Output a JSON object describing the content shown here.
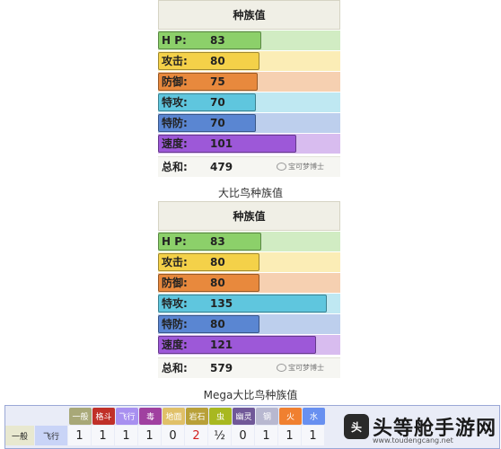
{
  "card1": {
    "title": "种族值",
    "stats": [
      {
        "label": "H P:",
        "value": "83",
        "fraction": 0.565,
        "color": "#8cd06a"
      },
      {
        "label": "攻击:",
        "value": "80",
        "fraction": 0.555,
        "color": "#f4d149"
      },
      {
        "label": "防御:",
        "value": "75",
        "fraction": 0.545,
        "color": "#e8893d"
      },
      {
        "label": "特攻:",
        "value": "70",
        "fraction": 0.535,
        "color": "#5fc6de"
      },
      {
        "label": "特防:",
        "value": "70",
        "fraction": 0.535,
        "color": "#5a86d2"
      },
      {
        "label": "速度:",
        "value": "101",
        "fraction": 0.76,
        "color": "#9d58d8"
      }
    ],
    "total_label": "总和:",
    "total_value": "479",
    "watermark": "宝可梦博士"
  },
  "caption1": "大比鸟种族值",
  "card2": {
    "title": "种族值",
    "stats": [
      {
        "label": "H P:",
        "value": "83",
        "fraction": 0.565,
        "color": "#8cd06a"
      },
      {
        "label": "攻击:",
        "value": "80",
        "fraction": 0.555,
        "color": "#f4d149"
      },
      {
        "label": "防御:",
        "value": "80",
        "fraction": 0.555,
        "color": "#e8893d"
      },
      {
        "label": "特攻:",
        "value": "135",
        "fraction": 0.925,
        "color": "#5fc6de"
      },
      {
        "label": "特防:",
        "value": "80",
        "fraction": 0.555,
        "color": "#5a86d2"
      },
      {
        "label": "速度:",
        "value": "121",
        "fraction": 0.865,
        "color": "#9d58d8"
      }
    ],
    "total_label": "总和:",
    "total_value": "579",
    "watermark": "宝可梦博士"
  },
  "caption2": "Mega大比鸟种族值",
  "typechart": {
    "headers": [
      {
        "label": "一般",
        "color": "#a8a878"
      },
      {
        "label": "格斗",
        "color": "#c03028"
      },
      {
        "label": "飞行",
        "color": "#a890f0"
      },
      {
        "label": "毒",
        "color": "#a040a0"
      },
      {
        "label": "地面",
        "color": "#e0c068"
      },
      {
        "label": "岩石",
        "color": "#b8a038"
      },
      {
        "label": "虫",
        "color": "#a8b820"
      },
      {
        "label": "幽灵",
        "color": "#705898"
      },
      {
        "label": "钢",
        "color": "#b8b8d0"
      },
      {
        "label": "火",
        "color": "#f08030"
      },
      {
        "label": "水",
        "color": "#6890f0"
      }
    ],
    "row_types": [
      "一般",
      "飞行"
    ],
    "row_colors": [
      "#e8e8d0",
      "#c9d4f7"
    ],
    "values": [
      {
        "text": "1",
        "red": false
      },
      {
        "text": "1",
        "red": false
      },
      {
        "text": "1",
        "red": false
      },
      {
        "text": "1",
        "red": false
      },
      {
        "text": "0",
        "red": false
      },
      {
        "text": "2",
        "red": true
      },
      {
        "text": "½",
        "red": false
      },
      {
        "text": "0",
        "red": false
      },
      {
        "text": "1",
        "red": false
      },
      {
        "text": "1",
        "red": false
      },
      {
        "text": "1",
        "red": false
      }
    ]
  },
  "logo": {
    "mark": "头",
    "text": "头等舱手游网",
    "url": "www.toudengcang.net"
  }
}
